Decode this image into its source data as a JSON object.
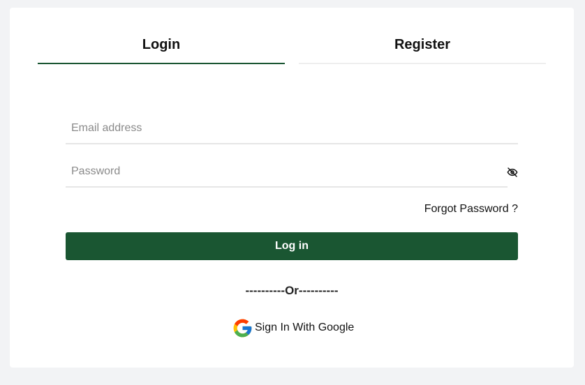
{
  "tabs": {
    "login_label": "Login",
    "register_label": "Register"
  },
  "form": {
    "email_placeholder": "Email address",
    "email_value": "",
    "password_placeholder": "Password",
    "password_value": "",
    "forgot_label": "Forgot Password ?",
    "login_button_label": "Log in",
    "divider_text": "----------Or----------",
    "google_label": "Sign In With Google"
  },
  "icons": {
    "password_toggle": "eye-slash-icon",
    "google": "google-icon"
  },
  "colors": {
    "primary": "#1a5632",
    "background": "#f2f3f5",
    "card": "#ffffff"
  }
}
